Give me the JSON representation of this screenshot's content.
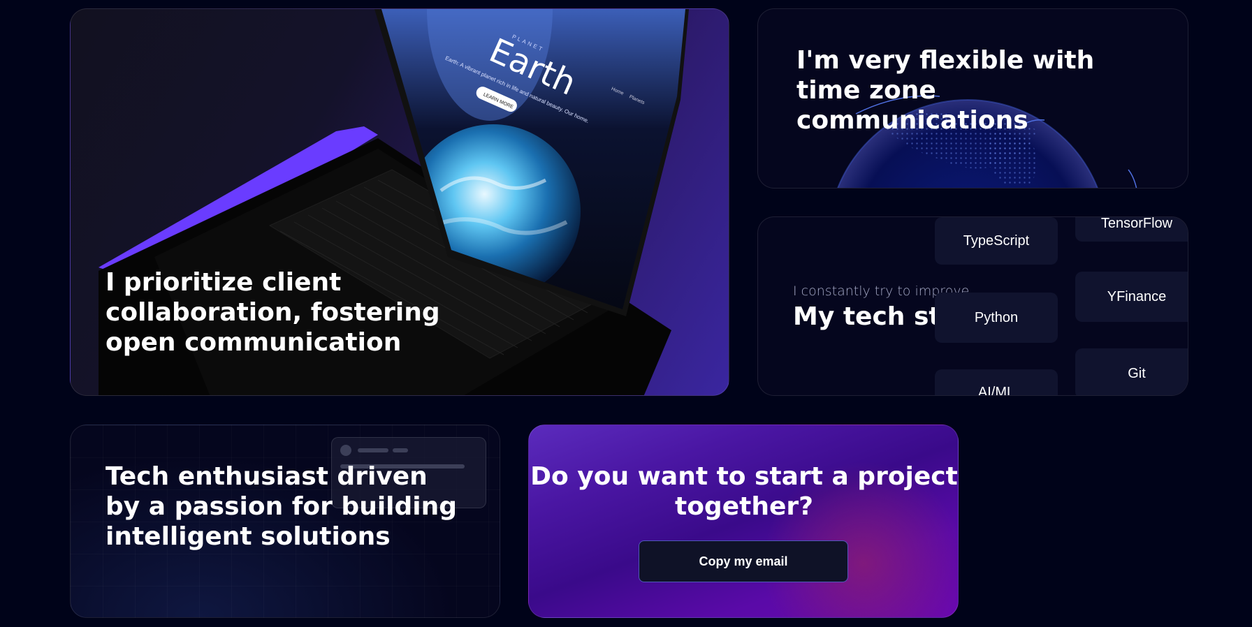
{
  "cards": {
    "collab": {
      "title": "I prioritize client collaboration, fostering open communication",
      "laptop_screen": {
        "planet_label": "PLANET",
        "brand": "Earth",
        "nav_home": "Home",
        "nav_planets": "Planets",
        "tagline": "Earth: A vibrant planet rich in life and natural beauty. Our home.",
        "cta": "LEARN MORE"
      }
    },
    "timezone": {
      "title": "I'm very flexible with time zone communications"
    },
    "stack": {
      "subtitle": "I constantly try to improve",
      "title": "My tech stack",
      "column_left": [
        "TypeScript",
        "Python",
        "AI/ML"
      ],
      "column_right": [
        "TensorFlow",
        "YFinance",
        "Git"
      ]
    },
    "enthusiast": {
      "title": "Tech enthusiast driven by a passion for building intelligent solutions"
    },
    "cta": {
      "title": "Do you want to start a project together?",
      "button_label": "Copy my email"
    }
  },
  "colors": {
    "background": "#000319",
    "card_dark": "#05061e",
    "pill_bg": "#10132e",
    "accent_purple": "#6a3cff",
    "cta_purple": "#5a0aa8",
    "button_border": "#4f58b8"
  }
}
